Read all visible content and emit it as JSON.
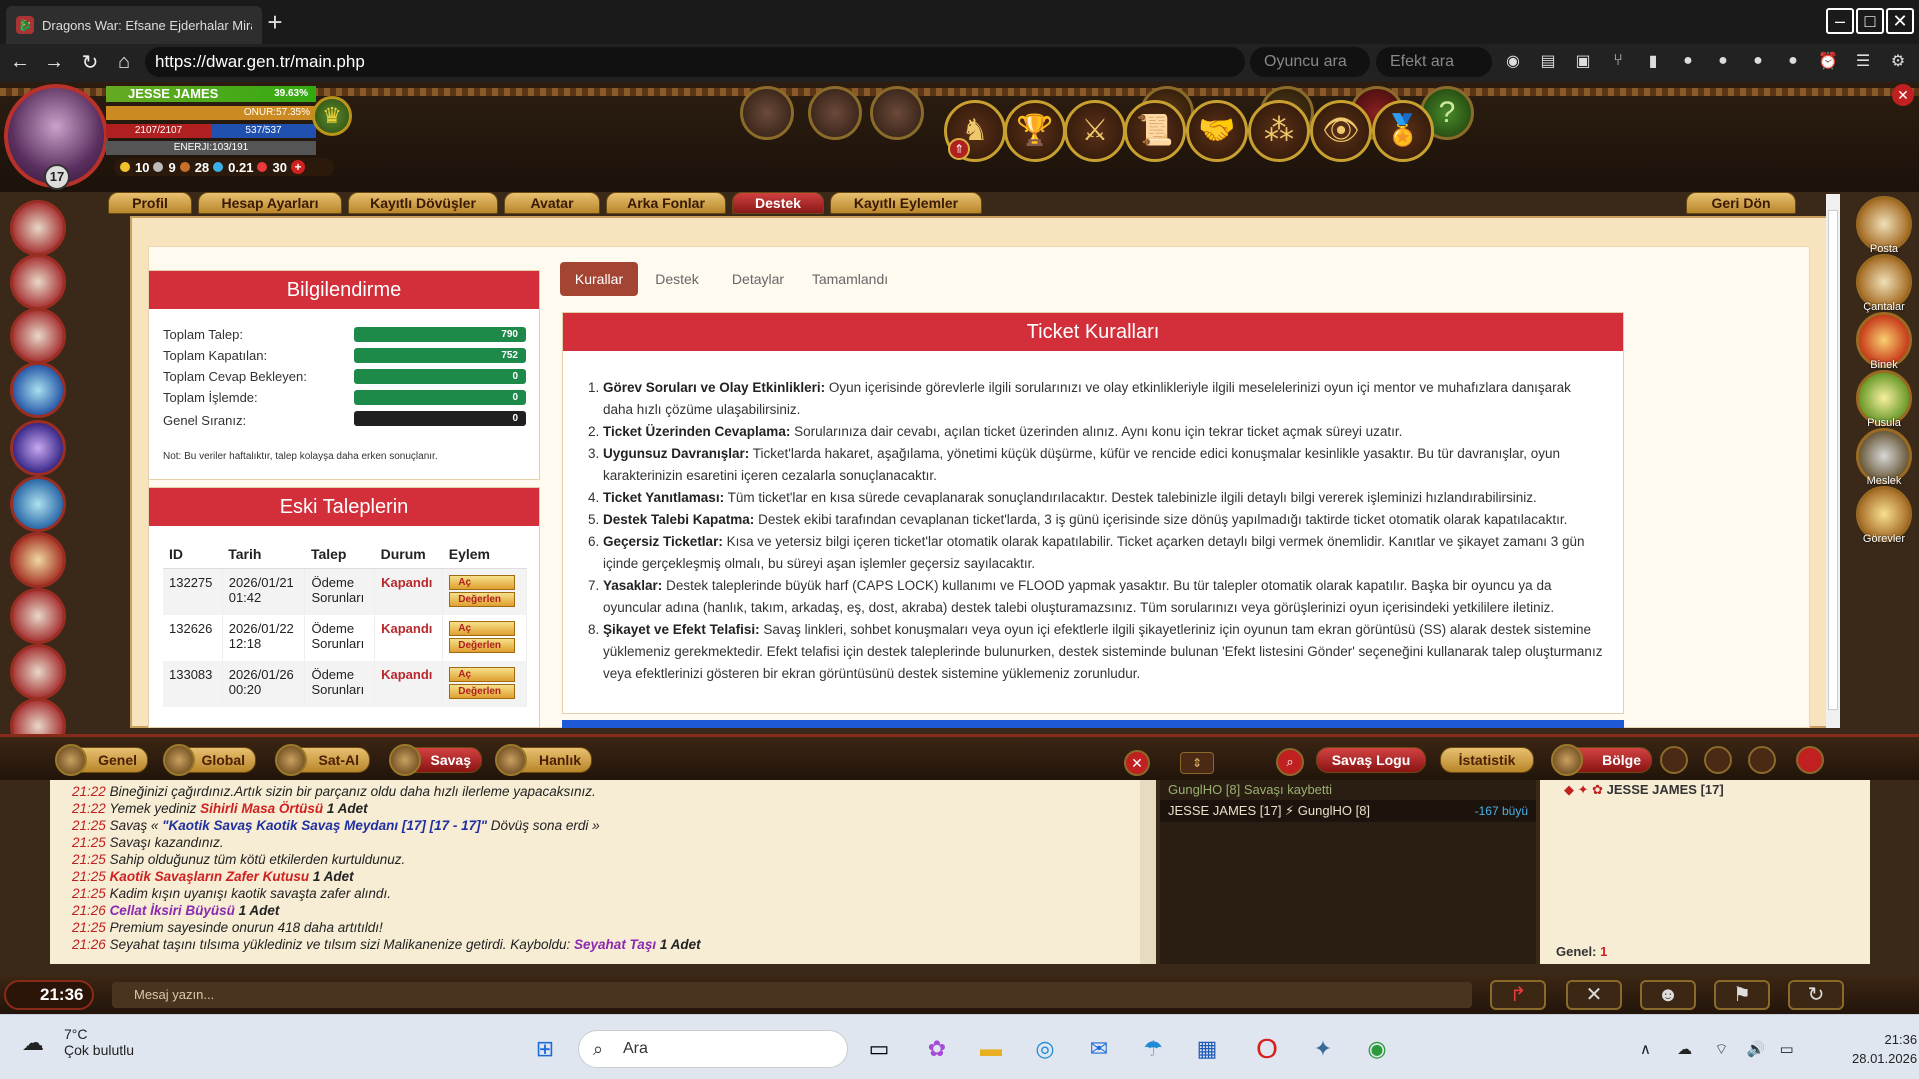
{
  "browser": {
    "tab_title": "Dragons War: Efsane Ejderhalar Mira",
    "url": "https://dwar.gen.tr/main.php",
    "search_player": "Oyuncu ara",
    "search_effect": "Efekt ara"
  },
  "player": {
    "name": "JESSE JAMES",
    "name_pct": "39.63%",
    "onur": "ONUR:57.35%",
    "hp": "2107/2107",
    "mp": "537/537",
    "energy": "ENERJI:103/191",
    "level": "17",
    "stats": [
      "10",
      "9",
      "28",
      "0.21",
      "30"
    ]
  },
  "menu_tabs": [
    "Profil",
    "Hesap Ayarları",
    "Kayıtlı Dövüşler",
    "Avatar",
    "Arka Fonlar",
    "Destek",
    "Kayıtlı Eylemler"
  ],
  "back_label": "Geri Dön",
  "info": {
    "title": "Bilgilendirme",
    "rows": [
      {
        "label": "Toplam Talep:",
        "value": "790",
        "color": "#1e8a4a"
      },
      {
        "label": "Toplam Kapatılan:",
        "value": "752",
        "color": "#1e8a4a"
      },
      {
        "label": "Toplam Cevap Bekleyen:",
        "value": "0",
        "color": "#1e8a4a"
      },
      {
        "label": "Toplam İşlemde:",
        "value": "0",
        "color": "#1e8a4a"
      },
      {
        "label": "Genel Sıranız:",
        "value": "0",
        "color": "#1f1f1f"
      }
    ],
    "note": "Not: Bu veriler haftalıktır, talep kolayşa daha erken sonuçlanır."
  },
  "old": {
    "title": "Eski Taleplerin",
    "headers": [
      "ID",
      "Tarih",
      "Talep",
      "Durum",
      "Eylem"
    ],
    "rows": [
      {
        "id": "132275",
        "date": "2026/01/21",
        "time": "01:42",
        "t1": "Ödeme",
        "t2": "Sorunları",
        "status": "Kapandı"
      },
      {
        "id": "132626",
        "date": "2026/01/22",
        "time": "12:18",
        "t1": "Ödeme",
        "t2": "Sorunları",
        "status": "Kapandı"
      },
      {
        "id": "133083",
        "date": "2026/01/26",
        "time": "00:20",
        "t1": "Ödeme",
        "t2": "Sorunları",
        "status": "Kapandı"
      }
    ],
    "open_label": "Aç",
    "rate_label": "Değerlen"
  },
  "rule_tabs": [
    "Kurallar",
    "Destek",
    "Detaylar",
    "Tamamlandı"
  ],
  "rules": {
    "title": "Ticket Kuralları",
    "items": [
      {
        "h": "Görev Soruları ve Olay Etkinlikleri:",
        "t": " Oyun içerisinde görevlerle ilgili sorularınızı ve olay etkinlikleriyle ilgili meselelerinizi oyun içi mentor ve muhafızlara danışarak daha hızlı çözüme ulaşabilirsiniz."
      },
      {
        "h": "Ticket Üzerinden Cevaplama:",
        "t": " Sorularınıza dair cevabı, açılan ticket üzerinden alınız. Aynı konu için tekrar ticket açmak süreyi uzatır."
      },
      {
        "h": "Uygunsuz Davranışlar:",
        "t": " Ticket'larda hakaret, aşağılama, yönetimi küçük düşürme, küfür ve rencide edici konuşmalar kesinlikle yasaktır. Bu tür davranışlar, oyun karakterinizin esaretini içeren cezalarla sonuçlanacaktır."
      },
      {
        "h": "Ticket Yanıtlaması:",
        "t": " Tüm ticket'lar en kısa sürede cevaplanarak sonuçlandırılacaktır. Destek talebinizle ilgili detaylı bilgi vererek işleminizi hızlandırabilirsiniz."
      },
      {
        "h": "Destek Talebi Kapatma:",
        "t": " Destek ekibi tarafından cevaplanan ticket'larda, 3 iş günü içerisinde size dönüş yapılmadığı taktirde ticket otomatik olarak kapatılacaktır."
      },
      {
        "h": "Geçersiz Ticketlar:",
        "t": " Kısa ve yetersiz bilgi içeren ticket'lar otomatik olarak kapatılabilir. Ticket açarken detaylı bilgi vermek önemlidir. Kanıtlar ve şikayet zamanı 3 gün içinde gerçekleşmiş olmalı, bu süreyi aşan işlemler geçersiz sayılacaktır."
      },
      {
        "h": "Yasaklar:",
        "t": " Destek taleplerinde büyük harf (CAPS LOCK) kullanımı ve FLOOD yapmak yasaktır. Bu tür talepler otomatik olarak kapatılır. Başka bir oyuncu ya da oyuncular adına (hanlık, takım, arkadaş, eş, dost, akraba) destek talebi oluşturamazsınız. Tüm sorularınızı veya görüşlerinizi oyun içerisindeki yetkililere iletiniz."
      },
      {
        "h": "Şikayet ve Efekt Telafisi:",
        "t": " Savaş linkleri, sohbet konuşmaları veya oyun içi efektlerle ilgili şikayetleriniz için oyunun tam ekran görüntüsü (SS) alarak destek sistemine yüklemeniz gerekmektedir. Efekt telafisi için destek taleplerinde bulunurken, destek sisteminde bulunan 'Efekt listesini Gönder' seçeneğini kullanarak talep oluşturmanız veya efektlerinizi gösteren bir ekran görüntüsünü destek sistemine yüklemeniz zorunludur."
      }
    ]
  },
  "side_right_labels": [
    "Posta",
    "Çantalar",
    "Binek",
    "Pusula",
    "Meslek",
    "Görevler"
  ],
  "chat_tabs": [
    "Genel",
    "Global",
    "Sat-Al",
    "Savaş",
    "Hanlık"
  ],
  "log_tabs": [
    "Savaş Logu",
    "İstatistik"
  ],
  "region_tab": "Bölge",
  "chat": [
    {
      "time": "21:22",
      "html": "Bineğinizi çağırdınız.Artık sizin bir parçanız oldu daha hızlı ilerleme yapacaksınız."
    },
    {
      "time": "21:22",
      "html": "Yemek yediniz <b class=\"rd\">Sihirli Masa Örtüsü</b> <b>1 Adet</b>"
    },
    {
      "time": "21:25",
      "html": "Savaş « <b class=\"bl\">\"Kaotik Savaş Kaotik Savaş Meydanı [17] [17 - 17]\"</b> Dövüş sona erdi »"
    },
    {
      "time": "21:25",
      "html": "Savaşı kazandınız."
    },
    {
      "time": "21:25",
      "html": "Sahip olduğunuz tüm kötü etkilerden kurtuldunuz."
    },
    {
      "time": "21:25",
      "html": "<b class=\"rd\">Kaotik Savaşların Zafer Kutusu</b> <b>1 Adet</b>"
    },
    {
      "time": "21:25",
      "html": "Kadim kışın uyanışı kaotik savaşta zafer alındı."
    },
    {
      "time": "21:26",
      "html": "<b class=\"pu\">Cellat İksiri Büyüsü</b> <b>1 Adet</b>"
    },
    {
      "time": "21:25",
      "html": "Premium sayesinde onurun 418 daha artıtıldı!"
    },
    {
      "time": "21:26",
      "html": "Seyahat taşını tılsıma yüklediniz ve tılsım sizi Malikanenize getirdi. Kayboldu: <b class=\"pu\">Seyahat Taşı</b> <b>1 Adet</b>"
    }
  ],
  "log": {
    "line1": "GunglHO [8] Savaşı kaybetti",
    "line2": "JESSE JAMES [17]  ⚡ GunglHO [8]",
    "value": "-167 büyü"
  },
  "region": {
    "player": "JESSE JAMES [17]",
    "general_label": "Genel:",
    "general_value": "1"
  },
  "clock": "21:36",
  "msg_placeholder": "Mesaj yazın...",
  "taskbar": {
    "temp": "7°C",
    "weather": "Çok bulutlu",
    "search": "Ara",
    "time": "21:36",
    "date": "28.01.2026"
  }
}
